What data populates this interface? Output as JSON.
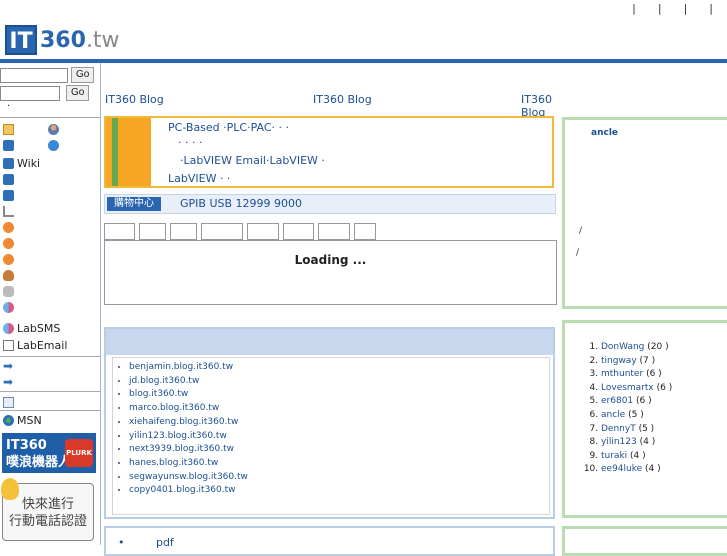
{
  "top_links": [
    "|",
    "|",
    "|",
    "|"
  ],
  "logo": {
    "mark": "IT",
    "name": "360",
    "tld": ".tw"
  },
  "sidebar": {
    "go_label_1": "Go",
    "go_label_2": "Go",
    "dot": "·",
    "items": [
      {
        "icon": "note-icon",
        "label": ""
      },
      {
        "icon": "book-icon",
        "label": "Wiki"
      },
      {
        "icon": "book-icon",
        "label": ""
      },
      {
        "icon": "book-icon",
        "label": ""
      },
      {
        "icon": "cart-icon",
        "label": ""
      },
      {
        "icon": "orange-icon",
        "label": ""
      },
      {
        "icon": "orange-icon",
        "label": ""
      },
      {
        "icon": "orange-icon",
        "label": ""
      },
      {
        "icon": "person-icon",
        "label": ""
      },
      {
        "icon": "disk-icon",
        "label": ""
      },
      {
        "icon": "pills-icon",
        "label": ""
      },
      {
        "icon": "pills-icon",
        "label": "LabSMS"
      },
      {
        "icon": "mail-icon",
        "label": "LabEmail"
      },
      {
        "icon": "arrow-icon",
        "label": ""
      },
      {
        "icon": "arrow-icon",
        "label": ""
      },
      {
        "icon": "table-icon",
        "label": ""
      },
      {
        "icon": "msn-icon",
        "label": "MSN"
      }
    ],
    "plurk": {
      "line1": "IT360",
      "line2": "噗浪機器人",
      "badge": "PLURK"
    },
    "mobile": {
      "line1": "快來進行",
      "line2": "行動電話認證"
    }
  },
  "nav": [
    "IT360 Blog",
    "IT360 Blog",
    "IT360 Blog"
  ],
  "promo": {
    "line1": "PC-Based ·PLC·PAC·  ·  ·",
    "line2": "·  ·  ·  ·",
    "line3": "·LabVIEW Email·LabVIEW    ·",
    "line4": "LabVIEW  ·  ·"
  },
  "shop": {
    "icon_label": "購物中心",
    "text": "GPIB USB  12999   9000"
  },
  "loading": "Loading ...",
  "blogs": [
    "benjamin.blog.it360.tw",
    "jd.blog.it360.tw",
    "blog.it360.tw",
    "marco.blog.it360.tw",
    "xiehaifeng.blog.it360.tw",
    "yilin123.blog.it360.tw",
    "next3939.blog.it360.tw",
    "hanes.blog.it360.tw",
    "segwayunsw.blog.it360.tw",
    "copy0401.blog.it360.tw"
  ],
  "pdf_label": "pdf",
  "right_profile": {
    "name": "ancle",
    "slash1": "/",
    "slash2": "/"
  },
  "ranking": [
    {
      "user": "DonWang",
      "count": "(20 )"
    },
    {
      "user": "tingway",
      "count": "(7 )"
    },
    {
      "user": "mthunter",
      "count": "(6 )"
    },
    {
      "user": "Lovesmartx",
      "count": "(6 )"
    },
    {
      "user": "er6801",
      "count": "(6 )"
    },
    {
      "user": "ancle",
      "count": "(5 )"
    },
    {
      "user": "DennyT",
      "count": "(5 )"
    },
    {
      "user": "yilin123",
      "count": "(4 )"
    },
    {
      "user": "turaki",
      "count": "(4 )"
    },
    {
      "user": "ee94luke",
      "count": "(4 )"
    }
  ]
}
